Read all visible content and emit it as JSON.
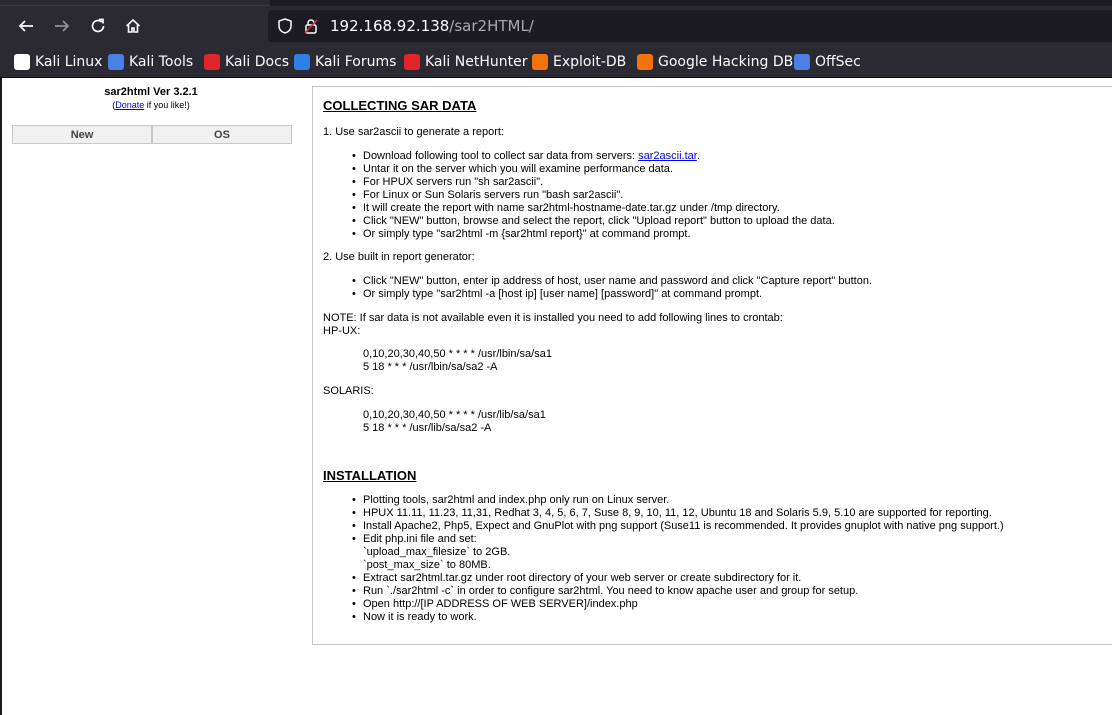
{
  "browser": {
    "url_host": "192.168.92.138",
    "url_path": "/sar2HTML/",
    "bookmarks": [
      {
        "label": "Kali Linux",
        "icon": "kali-dragon-icon",
        "color": "#ffffff"
      },
      {
        "label": "Kali Tools",
        "icon": "kali-tools-icon",
        "color": "#4a7fe6"
      },
      {
        "label": "Kali Docs",
        "icon": "kali-docs-icon",
        "color": "#e0262b"
      },
      {
        "label": "Kali Forums",
        "icon": "kali-forums-icon",
        "color": "#2f7fe6"
      },
      {
        "label": "Kali NetHunter",
        "icon": "kali-nethunter-icon",
        "color": "#e0262b"
      },
      {
        "label": "Exploit-DB",
        "icon": "exploit-db-icon",
        "color": "#f2730c"
      },
      {
        "label": "Google Hacking DB",
        "icon": "google-hacking-db-icon",
        "color": "#f2730c"
      },
      {
        "label": "OffSec",
        "icon": "offsec-icon",
        "color": "#4a7fe6"
      }
    ]
  },
  "sidebar": {
    "title": "sar2html Ver 3.2.1",
    "donate_prefix": "(",
    "donate_link": "Donate",
    "donate_suffix": " if you like!)",
    "buttons": [
      "New",
      "OS"
    ]
  },
  "content": {
    "heading1": "COLLECTING SAR DATA",
    "step1": "1. Use sar2ascii to generate a report:",
    "step1_items": [
      {
        "text": "Download following tool to collect sar data from servers: ",
        "link": "sar2ascii.tar",
        "after": "."
      },
      {
        "text": "Untar it on the server which you will examine performance data."
      },
      {
        "text": "For HPUX servers run \"sh sar2ascii\"."
      },
      {
        "text": "For Linux or Sun Solaris servers run \"bash sar2ascii\"."
      },
      {
        "text": "It will create the report with name sar2html-hostname-date.tar.gz under /tmp directory."
      },
      {
        "text": "Click \"NEW\" button, browse and select the report, click \"Upload report\" button to upload the data."
      },
      {
        "text": "Or simply type \"sar2html -m {sar2html report}\" at command prompt."
      }
    ],
    "step2": "2. Use built in report generator:",
    "step2_items": [
      "Click \"NEW\" button, enter ip address of host, user name and password and click \"Capture report\" button.",
      "Or simply type \"sar2html -a [host ip] [user name] [password]\" at command prompt."
    ],
    "note": "NOTE: If sar data is not available even it is installed you need to add following lines to crontab:",
    "hpux_label": "HP-UX:",
    "hpux_lines": [
      "0,10,20,30,40,50 * * * * /usr/lbin/sa/sa1",
      "5 18 * * * /usr/lbin/sa/sa2 -A"
    ],
    "solaris_label": "SOLARIS:",
    "solaris_lines": [
      "0,10,20,30,40,50 * * * * /usr/lib/sa/sa1",
      "5 18 * * * /usr/lib/sa/sa2 -A"
    ],
    "heading2": "INSTALLATION",
    "install_items": [
      "Plotting tools, sar2html and index.php only run on Linux server.",
      "HPUX 11.11, 11.23, 11,31, Redhat 3, 4, 5, 6, 7, Suse 8, 9, 10, 11, 12, Ubuntu 18 and Solaris 5.9, 5.10 are supported for reporting.",
      "Install Apache2, Php5, Expect and GnuPlot with png support (Suse11 is recommended. It provides gnuplot with native png support.)",
      "Edit php.ini file and set:",
      "Extract sar2html.tar.gz under root directory of your web server or create subdirectory for it.",
      "Run `./sar2html -c` in order to configure sar2html. You need to know apache user and group for setup.",
      "Open http://[IP ADDRESS OF WEB SERVER]/index.php",
      "Now it is ready to work."
    ],
    "phpini_lines": [
      "`upload_max_filesize` to 2GB.",
      "`post_max_size` to 80MB."
    ]
  }
}
